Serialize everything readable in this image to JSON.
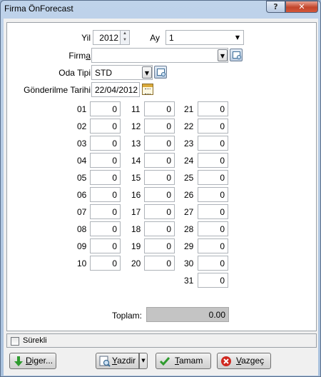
{
  "window": {
    "title": "Firma ÖnForecast",
    "help": "?",
    "close": "✕"
  },
  "form": {
    "yil_label": "Yil",
    "yil_value": "2012",
    "ay_label": "Ay",
    "ay_value": "1",
    "firma_label_pre": "Firm",
    "firma_label_mn": "a",
    "firma_value": "",
    "oda_label": "Oda Tipi",
    "oda_value": "STD",
    "gonderilme_label": "Gönderilme Tarihi",
    "gonderilme_value": "22/04/2012"
  },
  "days": [
    {
      "day": "01",
      "value": "0"
    },
    {
      "day": "02",
      "value": "0"
    },
    {
      "day": "03",
      "value": "0"
    },
    {
      "day": "04",
      "value": "0"
    },
    {
      "day": "05",
      "value": "0"
    },
    {
      "day": "06",
      "value": "0"
    },
    {
      "day": "07",
      "value": "0"
    },
    {
      "day": "08",
      "value": "0"
    },
    {
      "day": "09",
      "value": "0"
    },
    {
      "day": "10",
      "value": "0"
    },
    {
      "day": "11",
      "value": "0"
    },
    {
      "day": "12",
      "value": "0"
    },
    {
      "day": "13",
      "value": "0"
    },
    {
      "day": "14",
      "value": "0"
    },
    {
      "day": "15",
      "value": "0"
    },
    {
      "day": "16",
      "value": "0"
    },
    {
      "day": "17",
      "value": "0"
    },
    {
      "day": "18",
      "value": "0"
    },
    {
      "day": "19",
      "value": "0"
    },
    {
      "day": "20",
      "value": "0"
    },
    {
      "day": "21",
      "value": "0"
    },
    {
      "day": "22",
      "value": "0"
    },
    {
      "day": "23",
      "value": "0"
    },
    {
      "day": "24",
      "value": "0"
    },
    {
      "day": "25",
      "value": "0"
    },
    {
      "day": "26",
      "value": "0"
    },
    {
      "day": "27",
      "value": "0"
    },
    {
      "day": "28",
      "value": "0"
    },
    {
      "day": "29",
      "value": "0"
    },
    {
      "day": "30",
      "value": "0"
    },
    {
      "day": "31",
      "value": "0"
    }
  ],
  "total": {
    "label": "Toplam:",
    "value": "0.00"
  },
  "surekli_label": "Sürekli",
  "buttons": {
    "diger_mn": "D",
    "diger_rest": "iger...",
    "yazdir_mn": "Y",
    "yazdir_rest": "azdir",
    "tamam_mn": "T",
    "tamam_rest": "amam",
    "vazgec_mn": "V",
    "vazgec_rest": "azgeç"
  },
  "icons": {
    "diger": "arrow-down-icon",
    "yazdir": "print-preview-icon",
    "tamam": "checkmark-icon",
    "vazgec": "cancel-icon",
    "lookup": "lookup-icon",
    "calendar": "calendar-icon"
  },
  "colors": {
    "accent_green": "#2e9b2e",
    "cancel_red": "#d0281f",
    "disabled_total": "#c4c4c4"
  }
}
